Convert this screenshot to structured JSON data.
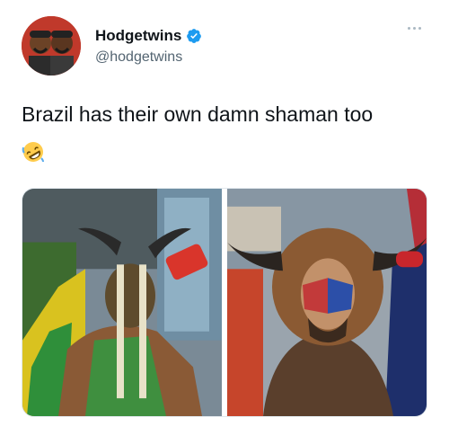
{
  "author": {
    "display_name": "Hodgetwins",
    "handle": "@hodgetwins",
    "verified": true,
    "avatar_icon": "avatar-photo"
  },
  "tweet": {
    "text": "Brazil has their own damn shaman too",
    "emoji": "rolling-on-floor-laughing-emoji"
  },
  "media": {
    "left_photo": "brazil-shaman-photo",
    "right_photo": "capitol-shaman-photo"
  },
  "colors": {
    "verified_blue": "#1d9bf0",
    "handle_gray": "#536471"
  }
}
